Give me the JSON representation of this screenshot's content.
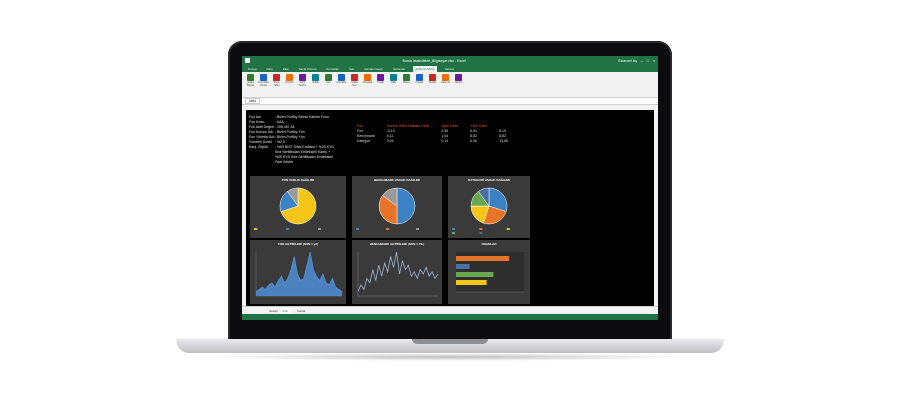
{
  "window": {
    "title": "Borsa İstatistikleri_Bilgisayar.xlsx - Excel",
    "user": "Ekonomi Aş"
  },
  "tabs": [
    "Dosya",
    "Giriş",
    "Ekle",
    "Sayfa Düzeni",
    "Formüller",
    "Veri",
    "Gözden Geçir",
    "Görünüm",
    "ANALİZ ARAÇ",
    "Yardım"
  ],
  "active_tab": "ANALİZ ARAÇ",
  "ribbon_buttons": [
    "Analiz Başlat",
    "Formülleri Göster",
    "Pivot Tablo",
    "Hazırla",
    "Tarih Seçimi",
    "Grafik",
    "Veri",
    "Fon Ekle",
    "Grafik Seç",
    "Hesapla",
    "Yenile",
    "Risk",
    "Rapor",
    "Kaydet",
    "Modül",
    "Satın Al",
    "Yardım"
  ],
  "formula_bar": {
    "cell": "A864"
  },
  "fund_info": [
    {
      "label": "Fon Adı",
      "value": ": Bizim Portföy Birinci Katılım Fonu"
    },
    {
      "label": "Fon Kodu",
      "value": ": AAA"
    },
    {
      "label": "Fon Aktif Değeri",
      "value": ": 198.467,45"
    },
    {
      "label": "Fon Kurucu Adı",
      "value": ": Bizim Portföy Yön."
    },
    {
      "label": "Fon Yönetici Adı",
      "value": ": Bizim Portföy Yön."
    },
    {
      "label": "Yönetim Ücreti",
      "value": ": %2,0"
    },
    {
      "label": "Karş. Ölçütü",
      "value": ": %50 BIST Sinai Endeksi + %25 KYD"
    },
    {
      "label": "",
      "value": "Kira Sertifikaları Endeksleri Kamu +"
    },
    {
      "label": "",
      "value": "%25 KYD Kira Sertifikaları Endeksleri"
    },
    {
      "label": "",
      "value": "Özel Sektör"
    }
  ],
  "stats": {
    "headers": [
      "Fon",
      "Günlük Getiri Haftalık Getiri",
      "Aylık Getiri",
      "Yıllık Getiri"
    ],
    "rows": [
      {
        "name": "Fon",
        "g1": "-0,10",
        "g2": "2,36",
        "g3": "6,51",
        "g4": "8,15"
      },
      {
        "name": "Benchmark",
        "g1": "0,11",
        "g2": "1,04",
        "g3": "8,82",
        "g4": "8,82"
      },
      {
        "name": "Kategori",
        "g1": "0,06",
        "g2": "0,14",
        "g3": "6,06",
        "g4": "13,65"
      }
    ]
  },
  "charts": {
    "fon_varlik": {
      "title": "FON VARLIK DAĞILIMI"
    },
    "benchmark": {
      "title": "BENCHMARK VARLIK DAĞILIMI"
    },
    "kategori": {
      "title": "KATEGORİ VARLIK DAĞILIMI"
    },
    "fon_getiri": {
      "title": "FON GETİRİLERİ (SON 1 yıl)"
    },
    "bench_getiri": {
      "title": "BENCHMARK GETİRİLERİ (SON 1 YIL)"
    },
    "oranlar": {
      "title": "ORANLAR"
    }
  },
  "chart_data": [
    {
      "type": "pie",
      "title": "FON VARLIK DAĞILIMI",
      "values": [
        70,
        20,
        10
      ],
      "colors": [
        "#f5c518",
        "#3b82c4",
        "#9a9a9a"
      ]
    },
    {
      "type": "pie",
      "title": "BENCHMARK VARLIK DAĞILIMI",
      "values": [
        50,
        35,
        15
      ],
      "colors": [
        "#3b82c4",
        "#e8742a",
        "#9a9a9a"
      ]
    },
    {
      "type": "pie",
      "title": "KATEGORİ VARLIK DAĞILIMI",
      "values": [
        30,
        25,
        20,
        15,
        10
      ],
      "colors": [
        "#3b82c4",
        "#e8742a",
        "#f5c518",
        "#6aa84f",
        "#4a6fa5"
      ]
    },
    {
      "type": "area",
      "title": "FON GETİRİLERİ (SON 1 yıl)",
      "values": [
        2,
        3,
        4,
        3,
        5,
        6,
        4,
        7,
        9,
        6,
        8,
        12,
        18,
        10,
        7,
        8,
        14,
        20,
        12,
        9,
        7,
        10,
        6,
        5,
        8,
        4,
        3,
        2
      ],
      "color": "#4f8fd6"
    },
    {
      "type": "line",
      "title": "BENCHMARK GETİRİLERİ (SON 1 YIL)",
      "values": [
        2,
        5,
        3,
        8,
        6,
        12,
        7,
        14,
        9,
        15,
        11,
        18,
        13,
        20,
        10,
        16,
        12,
        14,
        9,
        11,
        8,
        12,
        10,
        13,
        9,
        11,
        8,
        10
      ],
      "color": "#9ab3d6"
    },
    {
      "type": "bar",
      "title": "ORANLAR",
      "values": [
        78,
        20,
        55,
        45
      ],
      "colors": [
        "#e8742a",
        "#4a6fa5",
        "#6aa84f",
        "#f5c518"
      ]
    }
  ],
  "sheet_tabs": [
    "Hesap",
    "Fon",
    "Fonlar"
  ],
  "active_sheet": "Fon"
}
